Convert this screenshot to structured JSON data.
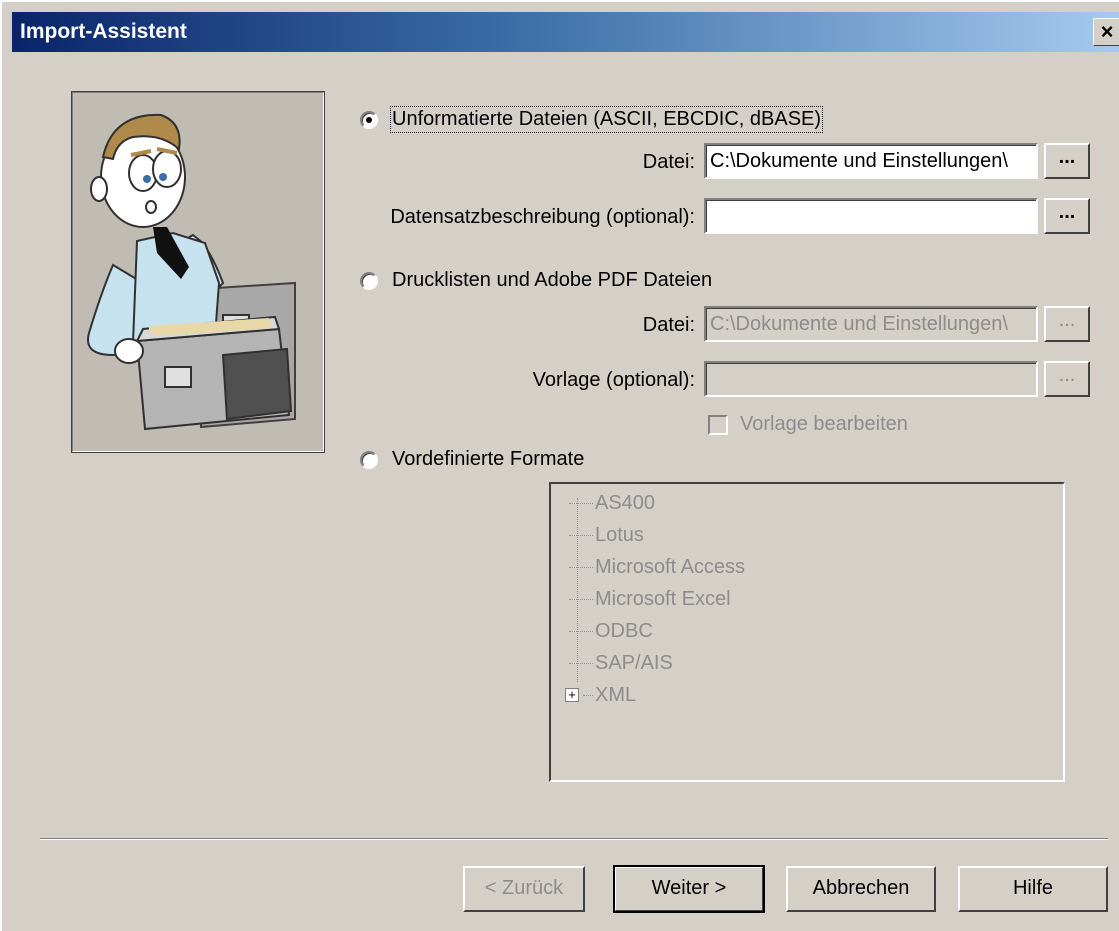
{
  "window": {
    "title": "Import-Assistent",
    "close_glyph": "×"
  },
  "options": {
    "unformatted": {
      "label": "Unformatierte Dateien (ASCII, EBCDIC, dBASE)",
      "selected": true,
      "file_label": "Datei:",
      "file_value": "C:\\Dokumente und Einstellungen\\",
      "record_label": "Datensatzbeschreibung (optional):",
      "record_value": "",
      "browse_label": "..."
    },
    "printlists": {
      "label": "Drucklisten und Adobe PDF Dateien",
      "selected": false,
      "file_label": "Datei:",
      "file_value": "C:\\Dokumente und Einstellungen\\",
      "template_label": "Vorlage (optional):",
      "template_value": "",
      "browse_label": "...",
      "edit_template_label": "Vorlage bearbeiten"
    },
    "predefined": {
      "label": "Vordefinierte Formate",
      "selected": false,
      "formats": [
        "AS400",
        "Lotus",
        "Microsoft Access",
        "Microsoft Excel",
        "ODBC",
        "SAP/AIS",
        "XML"
      ]
    }
  },
  "buttons": {
    "back": "< Zurück",
    "next": "Weiter >",
    "cancel": "Abbrechen",
    "help": "Hilfe"
  },
  "icons": {
    "illustration": "file-cabinet-man-illustration",
    "close": "close-icon",
    "expand": "plus-icon"
  }
}
